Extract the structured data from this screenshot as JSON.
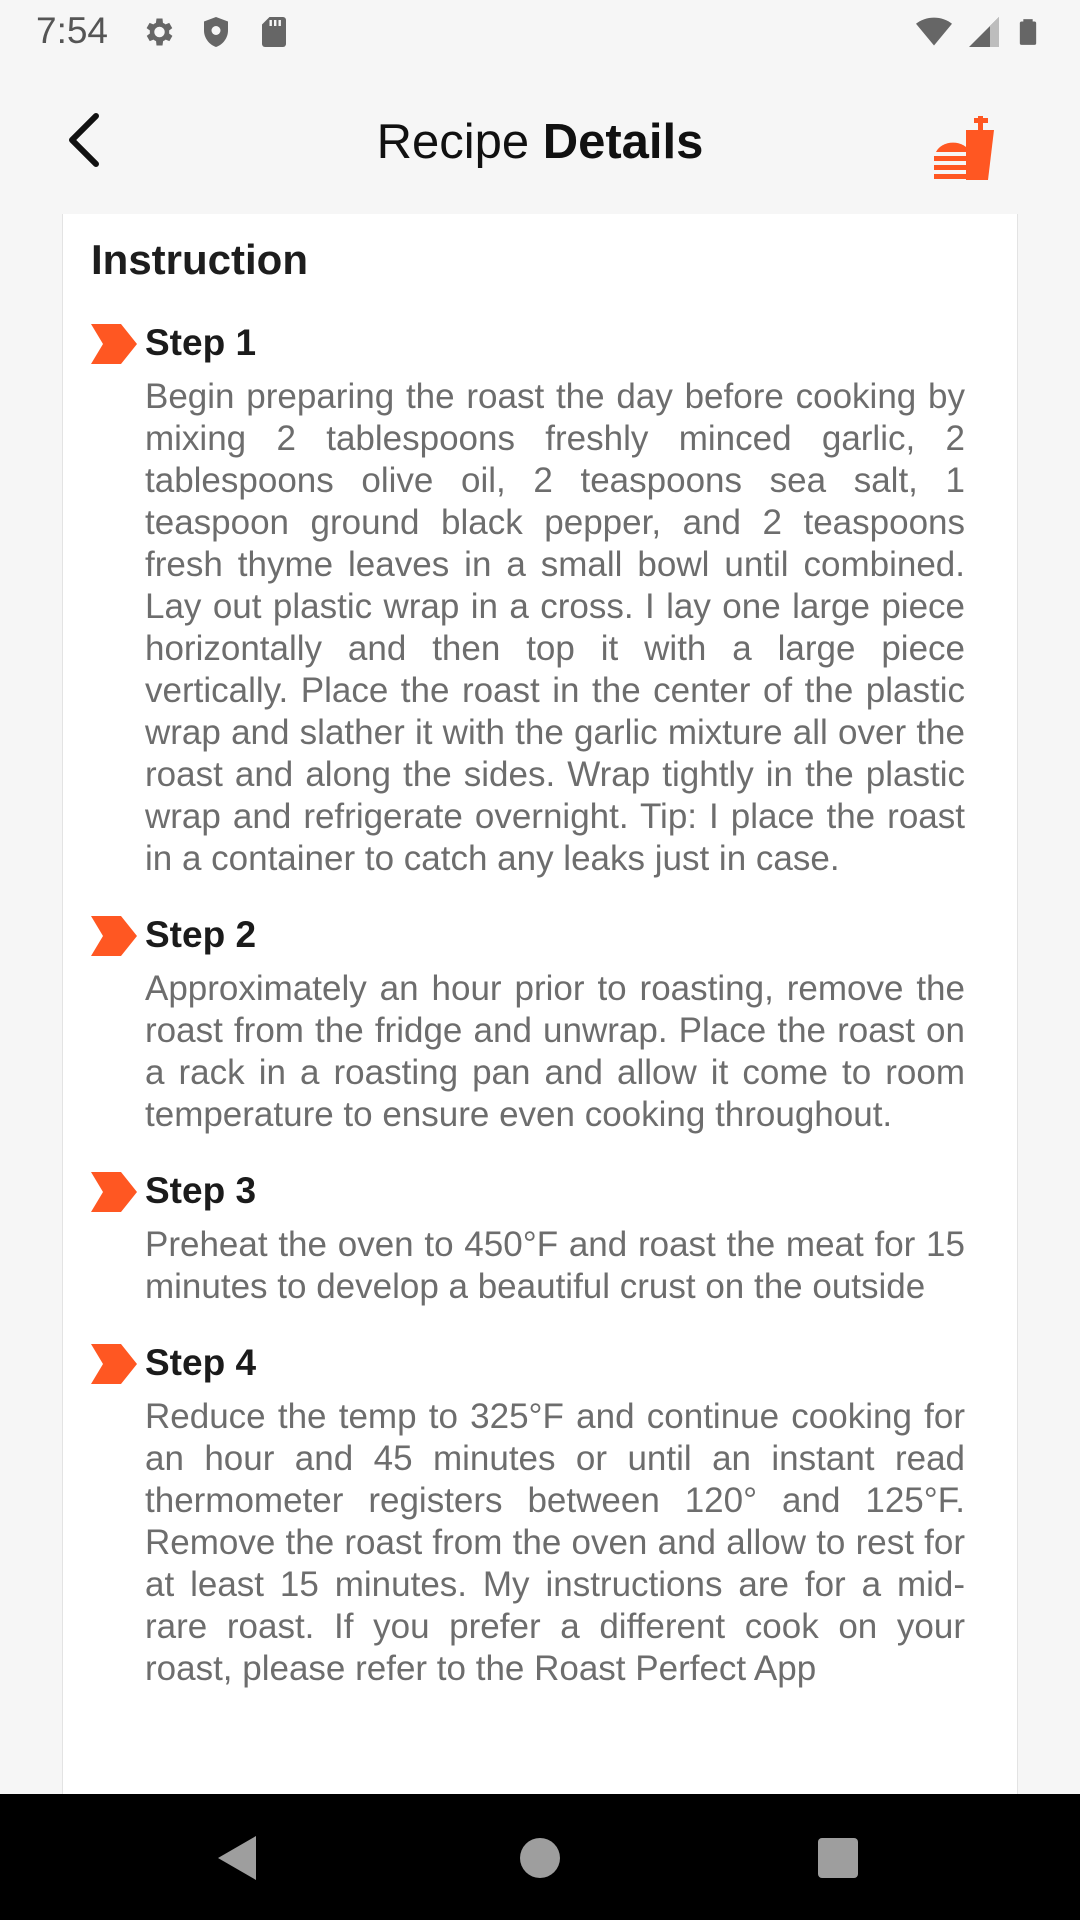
{
  "status_bar": {
    "time": "7:54",
    "left_icons": [
      "gear-icon",
      "shield-icon",
      "sd-card-icon"
    ],
    "right_icons": [
      "wifi-icon",
      "cell-signal-icon",
      "battery-icon"
    ]
  },
  "app_bar": {
    "title_regular": "Recipe ",
    "title_bold": "Details",
    "back_icon": "chevron-left-icon",
    "logo_icon": "food-logo-icon",
    "accent_color": "#FF5722"
  },
  "instruction": {
    "title": "Instruction",
    "steps": [
      {
        "title": "Step 1",
        "text": "Begin preparing the roast the day before cooking by mixing 2 tablespoons freshly minced garlic, 2 tablespoons olive oil, 2 teaspoons sea salt, 1 teaspoon ground black pepper, and 2 teaspoons fresh thyme leaves in a small bowl until combined. Lay out plastic wrap in a cross. I lay one large piece horizontally and then top it with a large piece vertically. Place the roast in the center of the plastic wrap and slather it with the garlic mixture all over the roast and along the sides. Wrap tightly in the plastic wrap and refrigerate overnight. Tip: I place the roast in a container to catch any leaks just in case."
      },
      {
        "title": "Step 2",
        "text": "Approximately an hour prior to roasting, remove the roast from the fridge and unwrap. Place the roast on a rack in a roasting pan and allow it come to room temperature to ensure even cooking throughout."
      },
      {
        "title": "Step 3",
        "text": "Preheat the oven to 450°F and roast the meat for 15 minutes to develop a beautiful crust on the outside"
      },
      {
        "title": "Step 4",
        "text": "Reduce the temp to 325°F and continue cooking for an hour and 45 minutes or until an instant read thermometer registers between 120° and 125°F. Remove the roast from the oven and allow to rest for at least 15 minutes. My instructions are for a mid-rare roast. If you prefer a different cook on your roast, please refer to the Roast Perfect App"
      }
    ]
  },
  "nav_bar": {
    "icons": [
      "back-triangle-icon",
      "home-circle-icon",
      "recents-square-icon"
    ]
  }
}
